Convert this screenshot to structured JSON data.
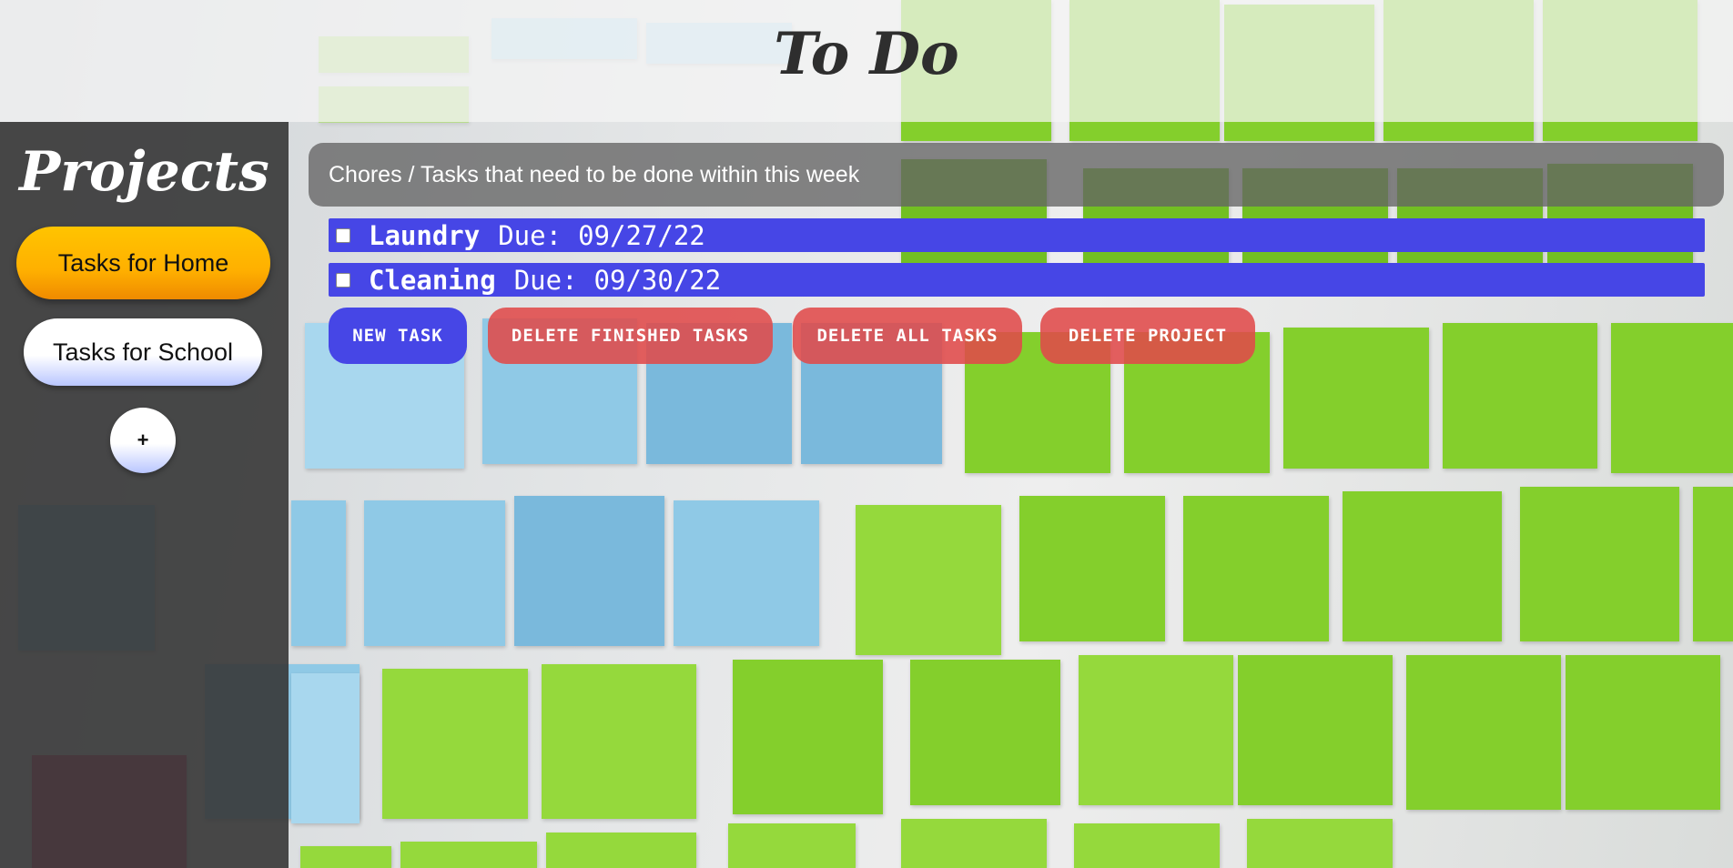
{
  "header": {
    "title": "To Do"
  },
  "sidebar": {
    "title": "Projects",
    "projects": [
      {
        "label": "Tasks for Home",
        "color": "#ffb000"
      },
      {
        "label": "Tasks for School",
        "color": "#ffffff"
      }
    ],
    "add_label": "+"
  },
  "main": {
    "project_description": "Chores / Tasks that need to be done within this week",
    "tasks": [
      {
        "name": "Laundry",
        "due_label": "Due:",
        "due": "09/27/22",
        "done": false
      },
      {
        "name": "Cleaning",
        "due_label": "Due:",
        "due": "09/30/22",
        "done": false
      }
    ],
    "actions": {
      "new_task": "NEW TASK",
      "delete_finished": "DELETE FINISHED TASKS",
      "delete_all": "DELETE ALL TASKS",
      "delete_project": "DELETE PROJECT"
    }
  },
  "colors": {
    "task_bar": "#4646e6",
    "danger": "#e04a4a",
    "accent_home": "#ffb000"
  }
}
